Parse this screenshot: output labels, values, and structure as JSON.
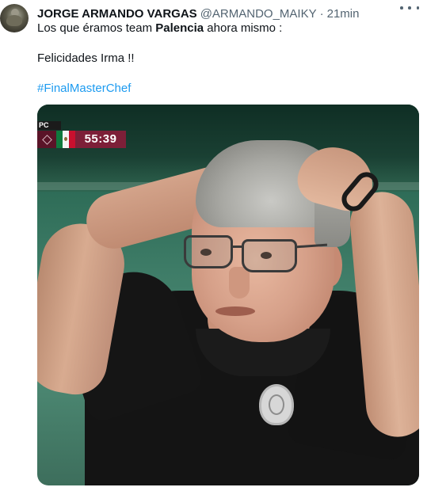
{
  "tweet": {
    "display_name": "JORGE ARMANDO VARGAS",
    "handle": "@ARMANDO_MAIKY",
    "separator": "·",
    "time": "21min",
    "text_line1_before": "Los que éramos team ",
    "text_line1_bold": "Palencia",
    "text_line1_after": " ahora mismo :",
    "text_line2": "Felicidades Irma !!",
    "hashtag": "#FinalMasterChef"
  },
  "media": {
    "scorebug_top": "PC",
    "clock": "55:39"
  },
  "colors": {
    "text": "#0f1419",
    "secondary": "#536471",
    "link": "#1d9bf0",
    "scorebug": "#7d1f38"
  },
  "icons": {
    "more": "more-horizontal-icon",
    "flag": "mexico-flag-icon"
  }
}
